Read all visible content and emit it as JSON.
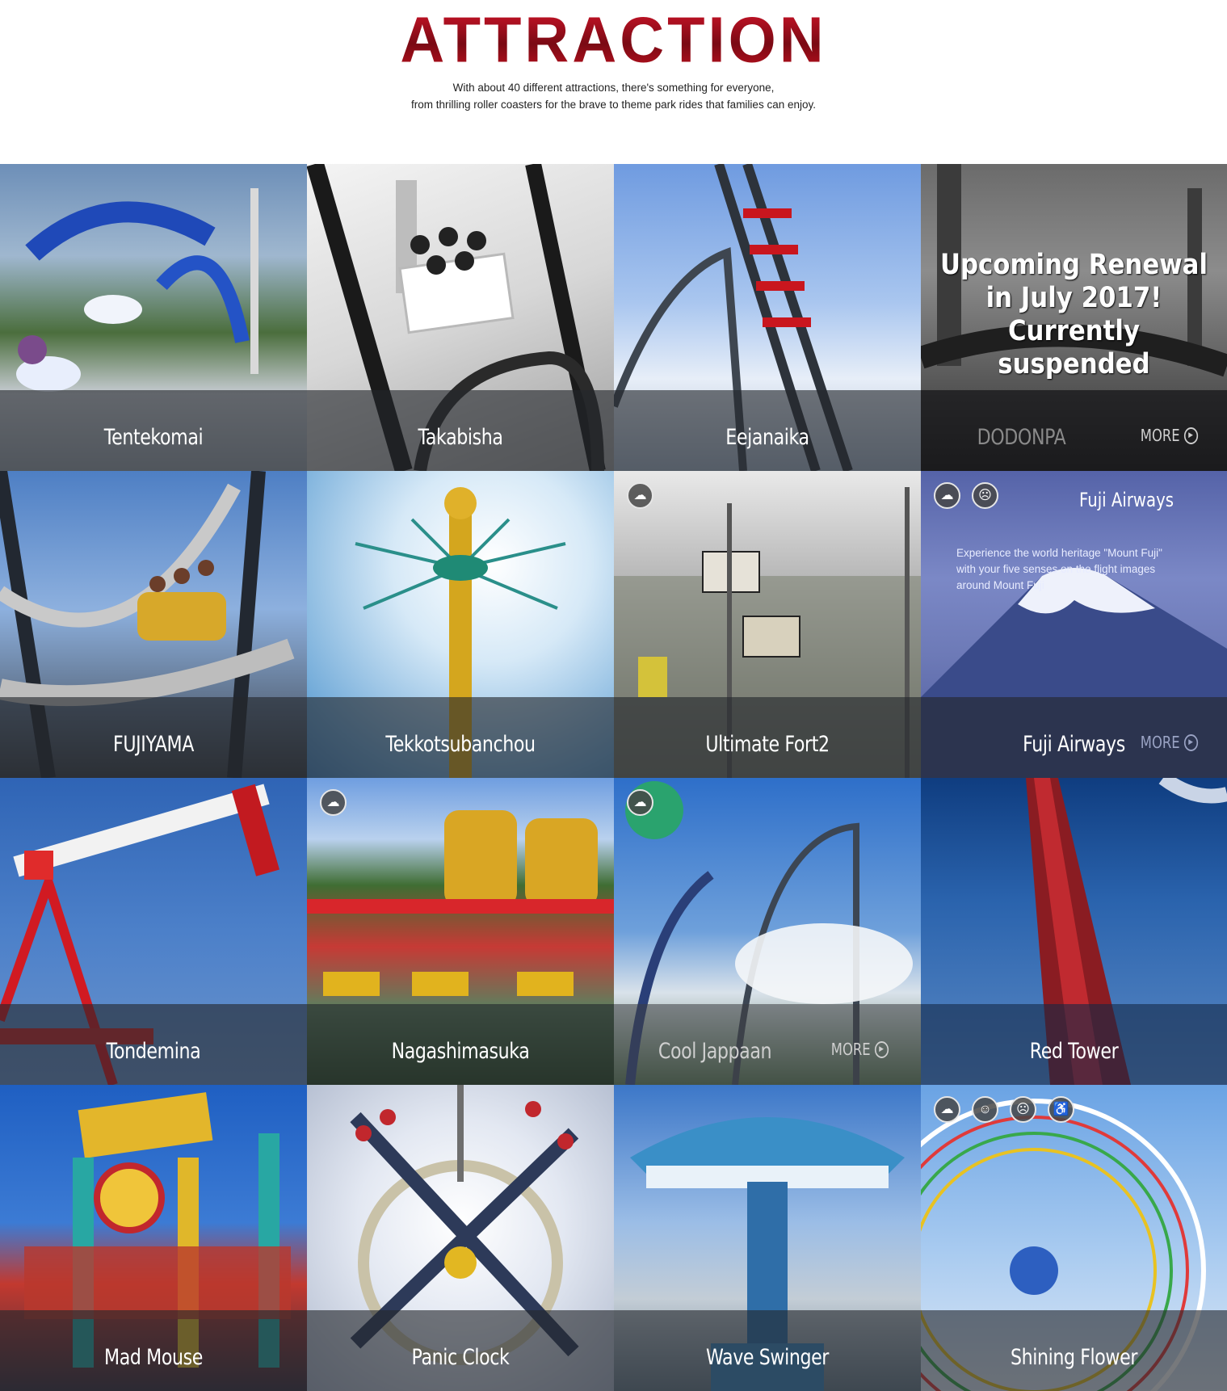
{
  "header": {
    "title": "ATTRACTION",
    "intro_line1": "With about 40 different attractions, there's something for everyone,",
    "intro_line2": "from thrilling roller coasters for the brave to theme park rides that families can enjoy."
  },
  "attractions": [
    {
      "name": "Tentekomai"
    },
    {
      "name": "Takabisha"
    },
    {
      "name": "Eejanaika"
    },
    {
      "name": "DODONPA",
      "notice_line1": "Upcoming Renewal",
      "notice_line2": "in July 2017!",
      "notice_line3": "Currently suspended",
      "more": "MORE"
    },
    {
      "name": "FUJIYAMA"
    },
    {
      "name": "Tekkotsubanchou"
    },
    {
      "name": "Ultimate Fort2"
    },
    {
      "name": "Fuji Airways",
      "overlay_title": "Fuji Airways",
      "desc_line1": "Experience the world heritage \"Mount Fuji\"",
      "desc_line2": "with your five senses on the flight images",
      "desc_line3": "around Mount Fuji",
      "more": "MORE"
    },
    {
      "name": "Tondemina"
    },
    {
      "name": "Nagashimasuka"
    },
    {
      "name": "Cool Jappaan",
      "more": "MORE"
    },
    {
      "name": "Red Tower"
    },
    {
      "name": "Mad Mouse"
    },
    {
      "name": "Panic Clock"
    },
    {
      "name": "Wave Swinger"
    },
    {
      "name": "Shining Flower"
    }
  ],
  "icons": {
    "rain": "rain-ok-icon",
    "happy": "smile-icon",
    "scared": "scared-icon",
    "wheelchair": "wheelchair-icon"
  }
}
